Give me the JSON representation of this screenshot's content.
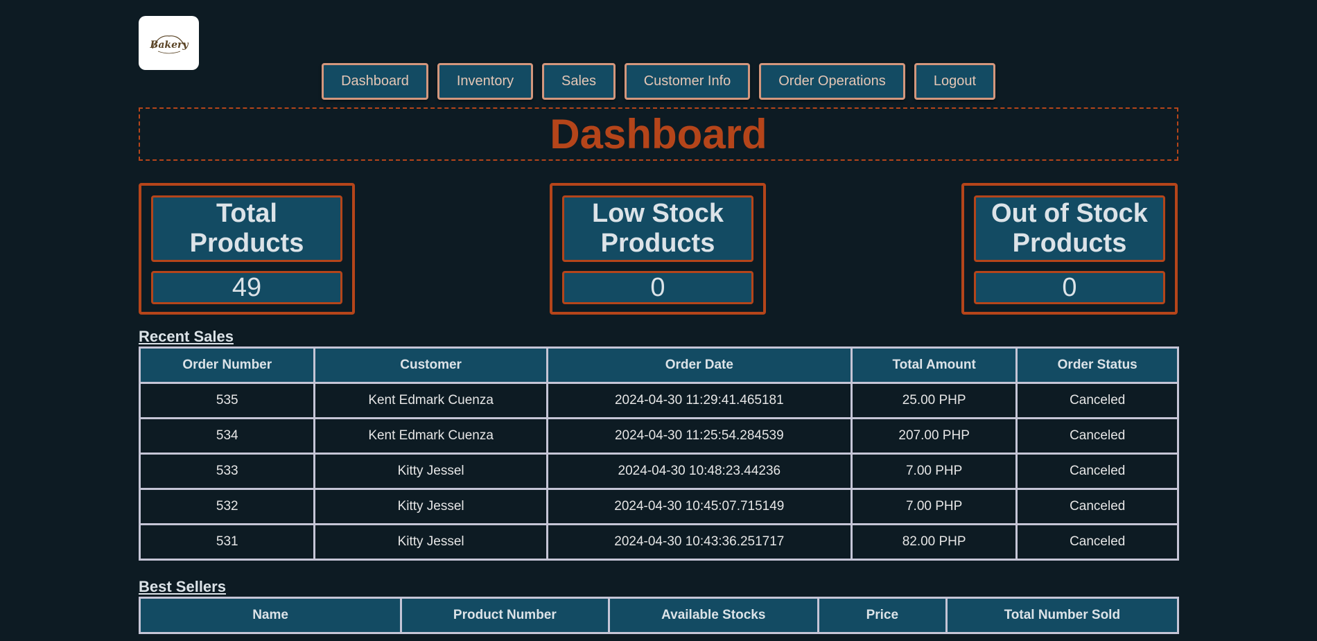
{
  "logo": {
    "text": "Bakery"
  },
  "nav": {
    "items": [
      {
        "label": "Dashboard"
      },
      {
        "label": "Inventory"
      },
      {
        "label": "Sales"
      },
      {
        "label": "Customer Info"
      },
      {
        "label": "Order Operations"
      },
      {
        "label": "Logout"
      }
    ]
  },
  "page": {
    "title": "Dashboard"
  },
  "stats": [
    {
      "label": "Total Products",
      "value": "49"
    },
    {
      "label": "Low Stock Products",
      "value": "0"
    },
    {
      "label": "Out of Stock Products",
      "value": "0"
    }
  ],
  "recent_sales": {
    "title": "Recent Sales",
    "columns": [
      "Order Number",
      "Customer",
      "Order Date",
      "Total Amount",
      "Order Status"
    ],
    "rows": [
      [
        "535",
        "Kent Edmark Cuenza",
        "2024-04-30 11:29:41.465181",
        "25.00 PHP",
        "Canceled"
      ],
      [
        "534",
        "Kent Edmark Cuenza",
        "2024-04-30 11:25:54.284539",
        "207.00 PHP",
        "Canceled"
      ],
      [
        "533",
        "Kitty Jessel",
        "2024-04-30 10:48:23.44236",
        "7.00 PHP",
        "Canceled"
      ],
      [
        "532",
        "Kitty Jessel",
        "2024-04-30 10:45:07.715149",
        "7.00 PHP",
        "Canceled"
      ],
      [
        "531",
        "Kitty Jessel",
        "2024-04-30 10:43:36.251717",
        "82.00 PHP",
        "Canceled"
      ]
    ]
  },
  "best_sellers": {
    "title": "Best Sellers",
    "columns": [
      "Name",
      "Product Number",
      "Available Stocks",
      "Price",
      "Total Number Sold"
    ]
  },
  "colors": {
    "background": "#0d1b23",
    "accent": "#b5451a",
    "header_fill": "#134b63",
    "nav_border": "#d4977d"
  }
}
